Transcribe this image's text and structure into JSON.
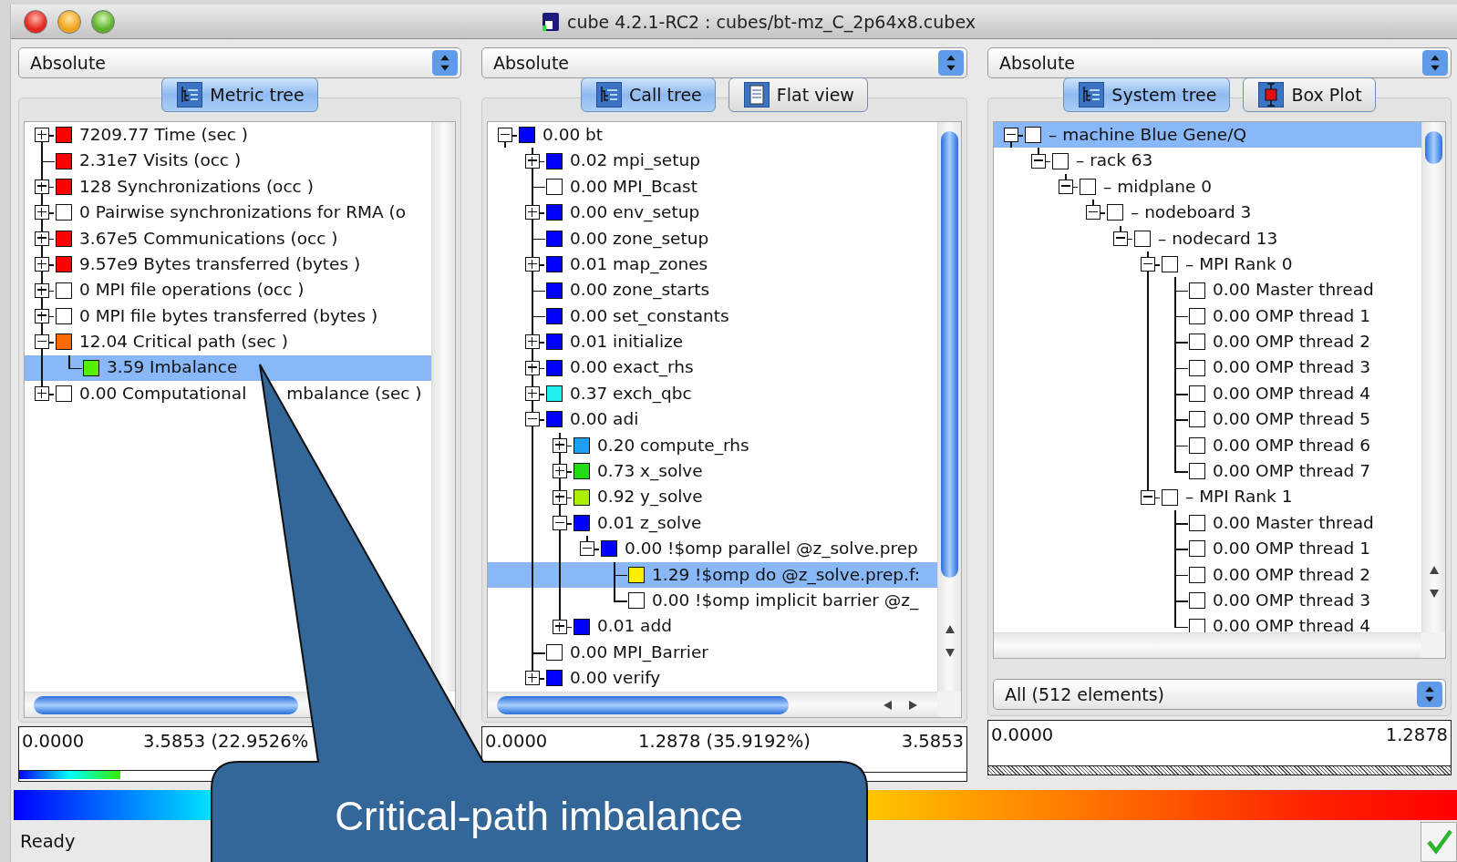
{
  "window": {
    "title": "cube 4.2.1-RC2 : cubes/bt-mz_C_2p64x8.cubex"
  },
  "panes": [
    {
      "mode": "Absolute",
      "tabs": [
        {
          "label": "Metric tree",
          "selected": true
        }
      ],
      "tree": [
        {
          "label": "7209.77 Time (sec )",
          "color": "#ff0000",
          "kind": "branch",
          "expanded": false,
          "selected": false
        },
        {
          "label": "2.31e7 Visits (occ )",
          "color": "#ff0000",
          "kind": "leaf",
          "selected": false
        },
        {
          "label": "128 Synchronizations (occ )",
          "color": "#ff0000",
          "kind": "branch",
          "expanded": false,
          "selected": false
        },
        {
          "label": "0 Pairwise synchronizations for RMA (o",
          "color": "#ffffff",
          "kind": "branch",
          "expanded": false,
          "selected": false
        },
        {
          "label": "3.67e5 Communications (occ )",
          "color": "#ff0000",
          "kind": "branch",
          "expanded": false,
          "selected": false
        },
        {
          "label": "9.57e9 Bytes transferred (bytes )",
          "color": "#ff0000",
          "kind": "branch",
          "expanded": false,
          "selected": false
        },
        {
          "label": "0 MPI file operations (occ )",
          "color": "#ffffff",
          "kind": "branch",
          "expanded": false,
          "selected": false
        },
        {
          "label": "0 MPI file bytes transferred (bytes )",
          "color": "#ffffff",
          "kind": "branch",
          "expanded": false,
          "selected": false
        },
        {
          "label": "12.04 Critical path (sec )",
          "color": "#ff6a00",
          "kind": "branch",
          "expanded": true,
          "selected": false,
          "children": [
            {
              "label": "3.59 Imbalance",
              "color": "#55ee00",
              "kind": "leaf",
              "selected": true
            }
          ]
        },
        {
          "label": "0.00 Computational",
          "label_after_callout": "mbalance (sec )",
          "color": "#ffffff",
          "kind": "branch",
          "expanded": false,
          "selected": false
        }
      ],
      "value_bar": {
        "kind": "gradient",
        "min": "0.0000",
        "current": "3.5853 (22.9526%",
        "level": 0.23
      }
    },
    {
      "mode": "Absolute",
      "tabs": [
        {
          "label": "Call tree",
          "selected": true
        },
        {
          "label": "Flat view",
          "selected": false
        }
      ],
      "tree": [
        {
          "label": "0.00 bt",
          "color": "#0000ff",
          "kind": "branch",
          "expanded": true,
          "selected": false,
          "children": [
            {
              "label": "0.02 mpi_setup",
              "color": "#0000ff",
              "kind": "branch",
              "expanded": false,
              "selected": false
            },
            {
              "label": "0.00 MPI_Bcast",
              "color": "#ffffff",
              "kind": "leaf",
              "selected": false
            },
            {
              "label": "0.00 env_setup",
              "color": "#0000ff",
              "kind": "branch",
              "expanded": false,
              "selected": false
            },
            {
              "label": "0.00 zone_setup",
              "color": "#0000ff",
              "kind": "leaf",
              "selected": false
            },
            {
              "label": "0.01 map_zones",
              "color": "#0000ff",
              "kind": "branch",
              "expanded": false,
              "selected": false
            },
            {
              "label": "0.00 zone_starts",
              "color": "#0000ff",
              "kind": "leaf",
              "selected": false
            },
            {
              "label": "0.00 set_constants",
              "color": "#0000ff",
              "kind": "leaf",
              "selected": false
            },
            {
              "label": "0.01 initialize",
              "color": "#0000ff",
              "kind": "branch",
              "expanded": false,
              "selected": false
            },
            {
              "label": "0.00 exact_rhs",
              "color": "#0000ff",
              "kind": "branch",
              "expanded": false,
              "selected": false
            },
            {
              "label": "0.37 exch_qbc",
              "color": "#22eeee",
              "kind": "branch",
              "expanded": false,
              "selected": false
            },
            {
              "label": "0.00 adi",
              "color": "#0000ff",
              "kind": "branch",
              "expanded": true,
              "selected": false,
              "children": [
                {
                  "label": "0.20 compute_rhs",
                  "color": "#1e9ff0",
                  "kind": "branch",
                  "expanded": false,
                  "selected": false
                },
                {
                  "label": "0.73 x_solve",
                  "color": "#22dd11",
                  "kind": "branch",
                  "expanded": false,
                  "selected": false
                },
                {
                  "label": "0.92 y_solve",
                  "color": "#aaee00",
                  "kind": "branch",
                  "expanded": false,
                  "selected": false
                },
                {
                  "label": "0.01 z_solve",
                  "color": "#0000ff",
                  "kind": "branch",
                  "expanded": true,
                  "selected": false,
                  "children": [
                    {
                      "label": "0.00 !$omp parallel @z_solve.prep",
                      "color": "#0000ff",
                      "kind": "branch",
                      "expanded": true,
                      "selected": false,
                      "children": [
                        {
                          "label": "1.29 !$omp do @z_solve.prep.f:",
                          "color": "#ffee00",
                          "kind": "leaf",
                          "selected": true
                        },
                        {
                          "label": "0.00 !$omp implicit barrier @z_",
                          "color": "#ffffff",
                          "kind": "leaf",
                          "selected": false
                        }
                      ]
                    }
                  ]
                },
                {
                  "label": "0.01 add",
                  "color": "#0000ff",
                  "kind": "branch",
                  "expanded": false,
                  "selected": false
                }
              ]
            },
            {
              "label": "0.00 MPI_Barrier",
              "color": "#ffffff",
              "kind": "leaf",
              "selected": false
            },
            {
              "label": "0.00 verify",
              "color": "#0000ff",
              "kind": "branch",
              "expanded": false,
              "selected": false
            }
          ]
        }
      ],
      "value_bar": {
        "kind": "plain",
        "min": "0.0000",
        "current": "1.2878 (35.9192%)",
        "max": "3.5853"
      }
    },
    {
      "mode": "Absolute",
      "tabs": [
        {
          "label": "System tree",
          "selected": true
        },
        {
          "label": "Box Plot",
          "selected": false
        }
      ],
      "tree": [
        {
          "label": "– machine Blue Gene/Q",
          "color": "#ffffff",
          "kind": "branch",
          "expanded": true,
          "selected": true,
          "children": [
            {
              "label": "– rack 63",
              "color": "#ffffff",
              "kind": "branch",
              "expanded": true,
              "selected": false,
              "children": [
                {
                  "label": "– midplane 0",
                  "color": "#ffffff",
                  "kind": "branch",
                  "expanded": true,
                  "selected": false,
                  "children": [
                    {
                      "label": "– nodeboard 3",
                      "color": "#ffffff",
                      "kind": "branch",
                      "expanded": true,
                      "selected": false,
                      "children": [
                        {
                          "label": "– nodecard 13",
                          "color": "#ffffff",
                          "kind": "branch",
                          "expanded": true,
                          "selected": false,
                          "children": [
                            {
                              "label": "– MPI Rank 0",
                              "color": "#ffffff",
                              "kind": "branch",
                              "expanded": true,
                              "selected": false,
                              "children": [
                                {
                                  "label": "0.00 Master thread",
                                  "color": "#ffffff",
                                  "kind": "leaf",
                                  "selected": false
                                },
                                {
                                  "label": "0.00 OMP thread 1",
                                  "color": "#ffffff",
                                  "kind": "leaf",
                                  "selected": false
                                },
                                {
                                  "label": "0.00 OMP thread 2",
                                  "color": "#ffffff",
                                  "kind": "leaf",
                                  "selected": false
                                },
                                {
                                  "label": "0.00 OMP thread 3",
                                  "color": "#ffffff",
                                  "kind": "leaf",
                                  "selected": false
                                },
                                {
                                  "label": "0.00 OMP thread 4",
                                  "color": "#ffffff",
                                  "kind": "leaf",
                                  "selected": false
                                },
                                {
                                  "label": "0.00 OMP thread 5",
                                  "color": "#ffffff",
                                  "kind": "leaf",
                                  "selected": false
                                },
                                {
                                  "label": "0.00 OMP thread 6",
                                  "color": "#ffffff",
                                  "kind": "leaf",
                                  "selected": false
                                },
                                {
                                  "label": "0.00 OMP thread 7",
                                  "color": "#ffffff",
                                  "kind": "leaf",
                                  "selected": false
                                }
                              ]
                            },
                            {
                              "label": "– MPI Rank 1",
                              "color": "#ffffff",
                              "kind": "branch",
                              "expanded": true,
                              "selected": false,
                              "children": [
                                {
                                  "label": "0.00 Master thread",
                                  "color": "#ffffff",
                                  "kind": "leaf",
                                  "selected": false
                                },
                                {
                                  "label": "0.00 OMP thread 1",
                                  "color": "#ffffff",
                                  "kind": "leaf",
                                  "selected": false
                                },
                                {
                                  "label": "0.00 OMP thread 2",
                                  "color": "#ffffff",
                                  "kind": "leaf",
                                  "selected": false
                                },
                                {
                                  "label": "0.00 OMP thread 3",
                                  "color": "#ffffff",
                                  "kind": "leaf",
                                  "selected": false
                                },
                                {
                                  "label": "0.00 OMP thread 4",
                                  "color": "#ffffff",
                                  "kind": "leaf",
                                  "selected": false
                                }
                              ]
                            }
                          ]
                        }
                      ]
                    }
                  ]
                }
              ]
            }
          ]
        }
      ],
      "filter": "All (512 elements)",
      "value_bar": {
        "kind": "hatched",
        "min": "0.0000",
        "max": "1.2878"
      }
    }
  ],
  "status_bar": {
    "text": "Ready"
  },
  "callout": {
    "text": "Critical-path imbalance"
  }
}
